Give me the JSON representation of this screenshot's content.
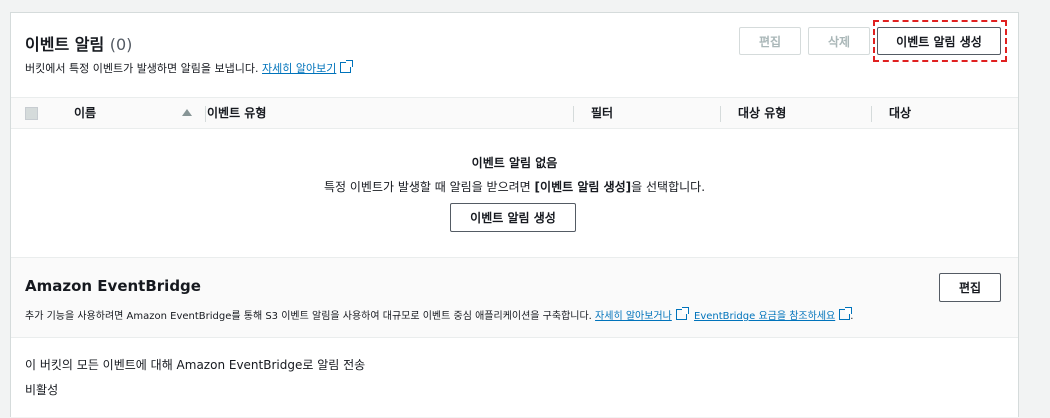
{
  "header": {
    "title": "이벤트 알림",
    "count": "(0)",
    "description": "버킷에서 특정 이벤트가 발생하면 알림을 보냅니다.",
    "learn_more": "자세히 알아보기"
  },
  "toolbar": {
    "edit_label": "편집",
    "delete_label": "삭제",
    "create_label": "이벤트 알림 생성"
  },
  "table": {
    "columns": [
      "이름",
      "이벤트 유형",
      "필터",
      "대상 유형",
      "대상"
    ]
  },
  "empty_state": {
    "title": "이벤트 알림 없음",
    "desc_before": "특정 이벤트가 발생할 때 알림을 받으려면 ",
    "desc_bold": "[이벤트 알림 생성]",
    "desc_after": "을 선택합니다.",
    "button_label": "이벤트 알림 생성"
  },
  "eventbridge": {
    "title": "Amazon EventBridge",
    "edit_label": "편집",
    "description": "추가 기능을 사용하려면 Amazon EventBridge를 통해 S3 이벤트 알림을 사용하여 대규모로 이벤트 중심 애플리케이션을 구축합니다.",
    "link1": "자세히 알아보거나",
    "link2": "EventBridge 요금을 참조하세요",
    "period": "."
  },
  "status": {
    "label": "이 버킷의 모든 이벤트에 대해 Amazon EventBridge로 알림 전송",
    "value": "비활성"
  }
}
